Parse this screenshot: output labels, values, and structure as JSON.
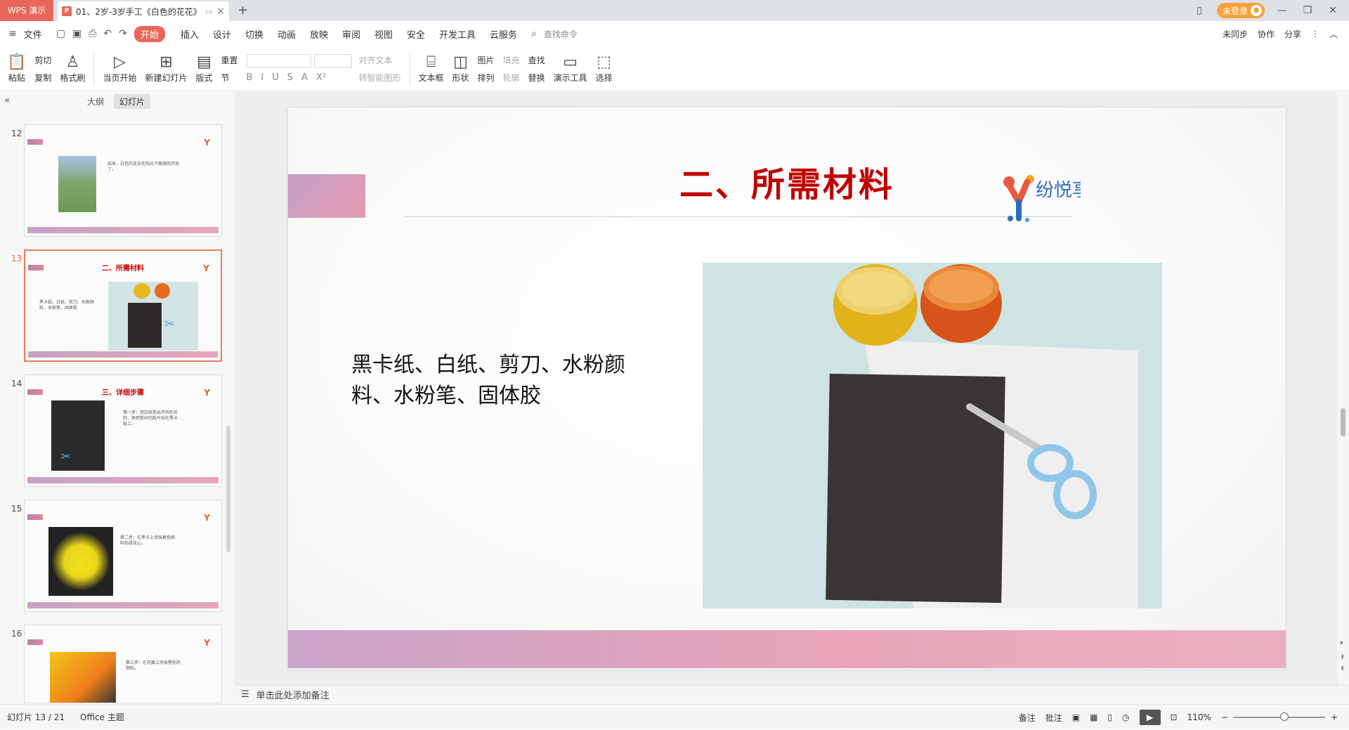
{
  "tabbar": {
    "app_label": "WPS 演示",
    "doc_title": "01、2岁-3岁手工《白色的花花》",
    "ppt_icon": "P",
    "new_tab": "+",
    "login_label": "未登录"
  },
  "menu": {
    "file": "文件",
    "items": [
      "开始",
      "插入",
      "设计",
      "切换",
      "动画",
      "放映",
      "审阅",
      "视图",
      "安全",
      "开发工具",
      "云服务"
    ],
    "search": "查找命令",
    "right": [
      "未同步",
      "协作",
      "分享"
    ]
  },
  "ribbon": {
    "paste": "粘贴",
    "cut": "剪切",
    "copy": "复制",
    "format_painter": "格式刷",
    "play_from_current": "当页开始",
    "new_slide": "新建幻灯片",
    "layout": "版式",
    "reset": "重置",
    "section": "节",
    "align_text": "对齐文本",
    "smart_shape": "转智能图形",
    "textbox": "文本框",
    "shape": "形状",
    "picture": "图片",
    "arrange": "排列",
    "fill": "填充",
    "outline": "轮廓",
    "find": "查找",
    "replace": "替换",
    "present_tools": "演示工具",
    "select": "选择"
  },
  "leftpane": {
    "tab_outline": "大纲",
    "tab_slides": "幻灯片",
    "thumbs": [
      {
        "num": "12",
        "title": "",
        "text": "后来，白色的花朵在阳光下美丽的开放了。"
      },
      {
        "num": "13",
        "title": "二、所需材料",
        "text": "黑卡纸、白纸、剪刀、水粉颜料、水粉笔、固体胶"
      },
      {
        "num": "14",
        "title": "三、详细步骤",
        "text": "第一步：用白纸剪出不同形状的，再把剪好的纸片贴在黑卡纸上。"
      },
      {
        "num": "15",
        "title": "",
        "text": "第二步：在黑卡上涂抹黄色颜料形成花心。"
      },
      {
        "num": "16",
        "title": "",
        "text": "第三步：在花瓣上涂抹橙色的颜料。"
      }
    ]
  },
  "slide": {
    "title": "二、所需材料",
    "body": "黑卡纸、白纸、剪刀、水粉颜料、水粉笔、固体胶",
    "logo_text": "纷悦享"
  },
  "notes": {
    "placeholder": "单击此处添加备注"
  },
  "status": {
    "slide_counter": "幻灯片 13 / 21",
    "theme": "Office 主题",
    "notes_btn": "备注",
    "comments_btn": "批注",
    "zoom": "110%"
  }
}
